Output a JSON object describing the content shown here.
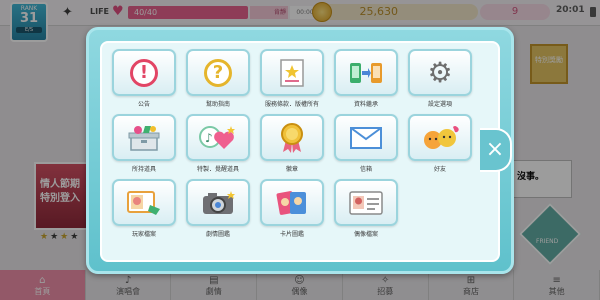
{
  "header": {
    "rank_label": "RANK",
    "rank_value": "31",
    "rank_sub": "E/S",
    "life_label": "LIFE",
    "life_value": "40/40",
    "life_timer_label": "肯靜",
    "life_timer": "00:00",
    "coins": "25,630",
    "gems": "9",
    "clock": "20:01"
  },
  "background": {
    "promo_text": "情人節期\n特別登入",
    "side_note": "沒事。",
    "event_label": "特別獎勵",
    "friend_label": "FRIEND"
  },
  "menu": {
    "items": [
      {
        "label": "公告",
        "icon": "alert-icon"
      },
      {
        "label": "幫助指南",
        "icon": "help-icon"
      },
      {
        "label": "服務條款．版權所有",
        "icon": "terms-icon"
      },
      {
        "label": "資料繼承",
        "icon": "transfer-icon"
      },
      {
        "label": "設定選項",
        "icon": "settings-icon"
      },
      {
        "label": "所持道具",
        "icon": "items-icon"
      },
      {
        "label": "特製．覺醒道具",
        "icon": "special-items-icon"
      },
      {
        "label": "徽章",
        "icon": "badge-icon"
      },
      {
        "label": "信箱",
        "icon": "mail-icon"
      },
      {
        "label": "好友",
        "icon": "friends-icon"
      },
      {
        "label": "玩家檔案",
        "icon": "player-profile-icon"
      },
      {
        "label": "劇情圖鑑",
        "icon": "story-gallery-icon"
      },
      {
        "label": "卡片圖鑑",
        "icon": "card-gallery-icon"
      },
      {
        "label": "偶像檔案",
        "icon": "idol-profile-icon"
      }
    ]
  },
  "bottom_nav": [
    {
      "label": "首頁"
    },
    {
      "label": "演唱會"
    },
    {
      "label": "劇情"
    },
    {
      "label": "偶像"
    },
    {
      "label": "招募"
    },
    {
      "label": "商店"
    },
    {
      "label": "其他"
    }
  ],
  "close_label": "×"
}
